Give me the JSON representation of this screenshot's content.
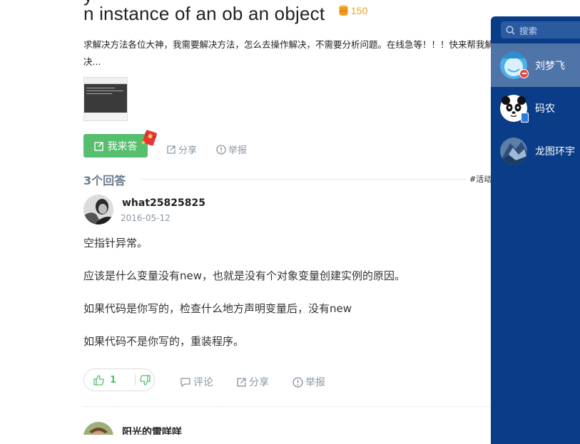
{
  "question": {
    "title_top_partial": "y",
    "title": "n instance of an ob an object",
    "bounty": "150",
    "body": "求解决方法各位大神，我需要解决方法，怎么去操作解决，不需要分析问题。在线急等！！！快来帮我解决..."
  },
  "actions": {
    "answer": "我来答",
    "share": "分享",
    "report": "举报"
  },
  "answers": {
    "count_label": "3个回答",
    "sort_label": "#活动"
  },
  "answer1": {
    "author": "what25825825",
    "date": "2016-05-12",
    "paragraphs": [
      "空指针异常。",
      "应该是什么变量没有new，也就是没有个对象变量创建实例的原因。",
      "如果代码是你写的，检查什么地方声明变量后，没有new",
      "如果代码不是你写的，重装程序。"
    ],
    "likes": "1",
    "comment": "评论",
    "share": "分享",
    "report": "举报"
  },
  "answer2": {
    "author": "阳光的雷咩咩"
  },
  "chat_panel": {
    "search_placeholder": "搜索",
    "contacts": [
      {
        "name": "刘梦飞",
        "status": "busy"
      },
      {
        "name": "码农",
        "status": "mobile"
      },
      {
        "name": "龙图环宇",
        "status": "none"
      }
    ]
  },
  "colors": {
    "accent_green": "#56bf6d",
    "bounty_orange": "#f29c1f",
    "panel_blue": "#0a3c87",
    "panel_active": "#4f74a8"
  }
}
